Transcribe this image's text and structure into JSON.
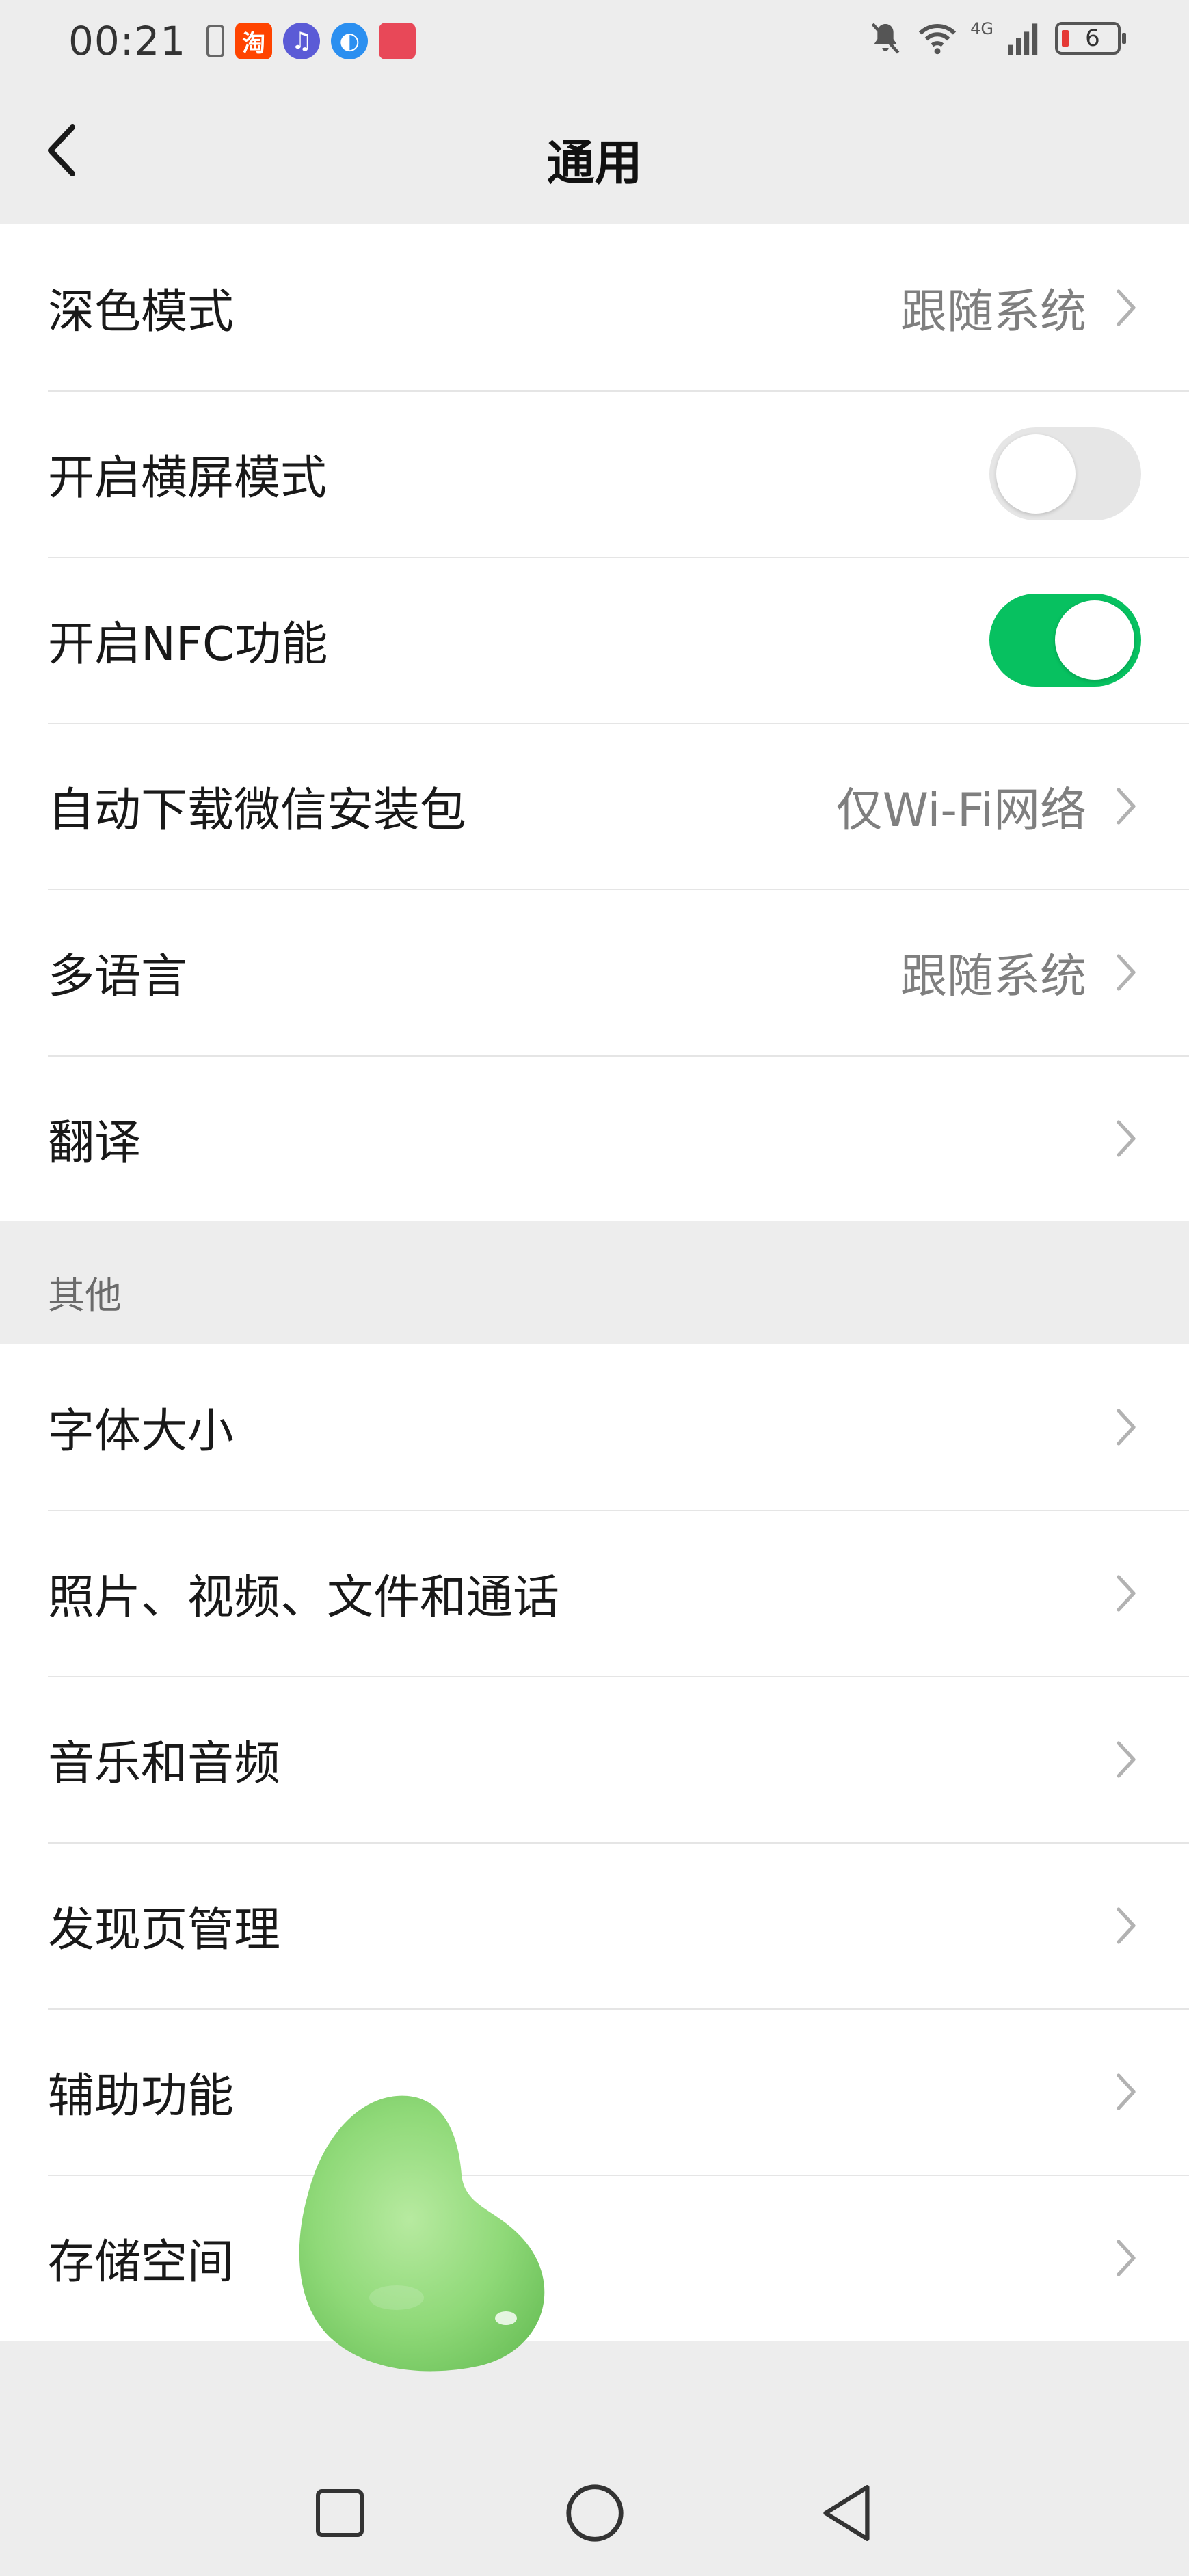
{
  "status_bar": {
    "time": "00:21",
    "app_icons": [
      {
        "name": "taobao-icon",
        "text": "淘",
        "color": "#ff4400"
      },
      {
        "name": "music-icon",
        "text": "♫",
        "color": "#5b5bd6"
      },
      {
        "name": "browser-icon",
        "text": "◐",
        "color": "#2b8ff0"
      },
      {
        "name": "huawei-app-icon",
        "text": "",
        "color": "#e84858"
      }
    ],
    "network_label": "4G",
    "battery_level": "6"
  },
  "header": {
    "title": "通用"
  },
  "settings_group_1": [
    {
      "label": "深色模式",
      "value": "跟随系统",
      "type": "link"
    },
    {
      "label": "开启横屏模式",
      "type": "toggle",
      "on": false
    },
    {
      "label": "开启NFC功能",
      "type": "toggle",
      "on": true
    },
    {
      "label": "自动下载微信安装包",
      "value": "仅Wi-Fi网络",
      "type": "link"
    },
    {
      "label": "多语言",
      "value": "跟随系统",
      "type": "link"
    },
    {
      "label": "翻译",
      "value": "",
      "type": "link"
    }
  ],
  "section_other": {
    "label": "其他"
  },
  "settings_group_2": [
    {
      "label": "字体大小"
    },
    {
      "label": "照片、视频、文件和通话"
    },
    {
      "label": "音乐和音频"
    },
    {
      "label": "发现页管理"
    },
    {
      "label": "辅助功能"
    },
    {
      "label": "存储空间"
    }
  ],
  "colors": {
    "toggle_on": "#07c160",
    "toggle_off": "#e6e6e6",
    "background": "#ededed"
  }
}
